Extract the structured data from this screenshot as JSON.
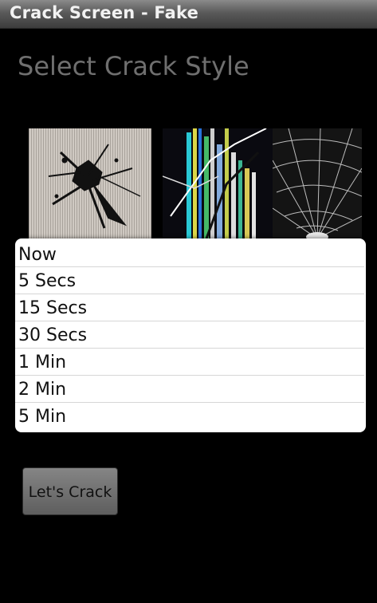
{
  "app": {
    "title": "Crack Screen - Fake"
  },
  "main": {
    "heading": "Select Crack Style"
  },
  "crack_styles": [
    {
      "icon": "cracked-screen-thumbnail-splatter-icon"
    },
    {
      "icon": "cracked-screen-thumbnail-colorful-lines-icon"
    },
    {
      "icon": "cracked-screen-thumbnail-web-icon"
    }
  ],
  "delay_options": [
    "Now",
    "5 Secs",
    "15 Secs",
    "30 Secs",
    "1 Min",
    "2 Min",
    "5 Min"
  ],
  "actions": {
    "crack_label": "Let's Crack"
  }
}
